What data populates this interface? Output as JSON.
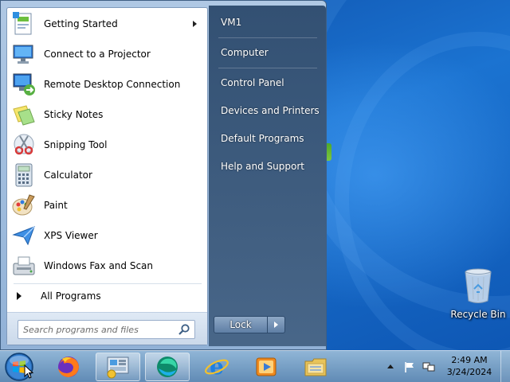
{
  "start_menu": {
    "programs": [
      {
        "label": "Getting Started",
        "icon": "getting-started-icon",
        "has_submenu": true
      },
      {
        "label": "Connect to a Projector",
        "icon": "projector-icon"
      },
      {
        "label": "Remote Desktop Connection",
        "icon": "remote-desktop-icon"
      },
      {
        "label": "Sticky Notes",
        "icon": "sticky-notes-icon"
      },
      {
        "label": "Snipping Tool",
        "icon": "snipping-tool-icon"
      },
      {
        "label": "Calculator",
        "icon": "calculator-icon"
      },
      {
        "label": "Paint",
        "icon": "paint-icon"
      },
      {
        "label": "XPS Viewer",
        "icon": "xps-viewer-icon"
      },
      {
        "label": "Windows Fax and Scan",
        "icon": "fax-scan-icon"
      }
    ],
    "all_programs_label": "All Programs",
    "search": {
      "placeholder": "Search programs and files"
    },
    "right_items": [
      {
        "label": "VM1"
      },
      {
        "label": "Computer"
      },
      {
        "label": "Control Panel"
      },
      {
        "label": "Devices and Printers"
      },
      {
        "label": "Default Programs"
      },
      {
        "label": "Help and Support"
      }
    ],
    "lock_label": "Lock"
  },
  "desktop": {
    "recycle_bin_label": "Recycle Bin"
  },
  "taskbar": {
    "pinned": [
      "firefox-icon",
      "control-panel-icon",
      "app-icon",
      "internet-explorer-icon",
      "media-player-icon",
      "file-explorer-icon"
    ],
    "clock": {
      "time": "2:49 AM",
      "date": "3/24/2024"
    }
  }
}
